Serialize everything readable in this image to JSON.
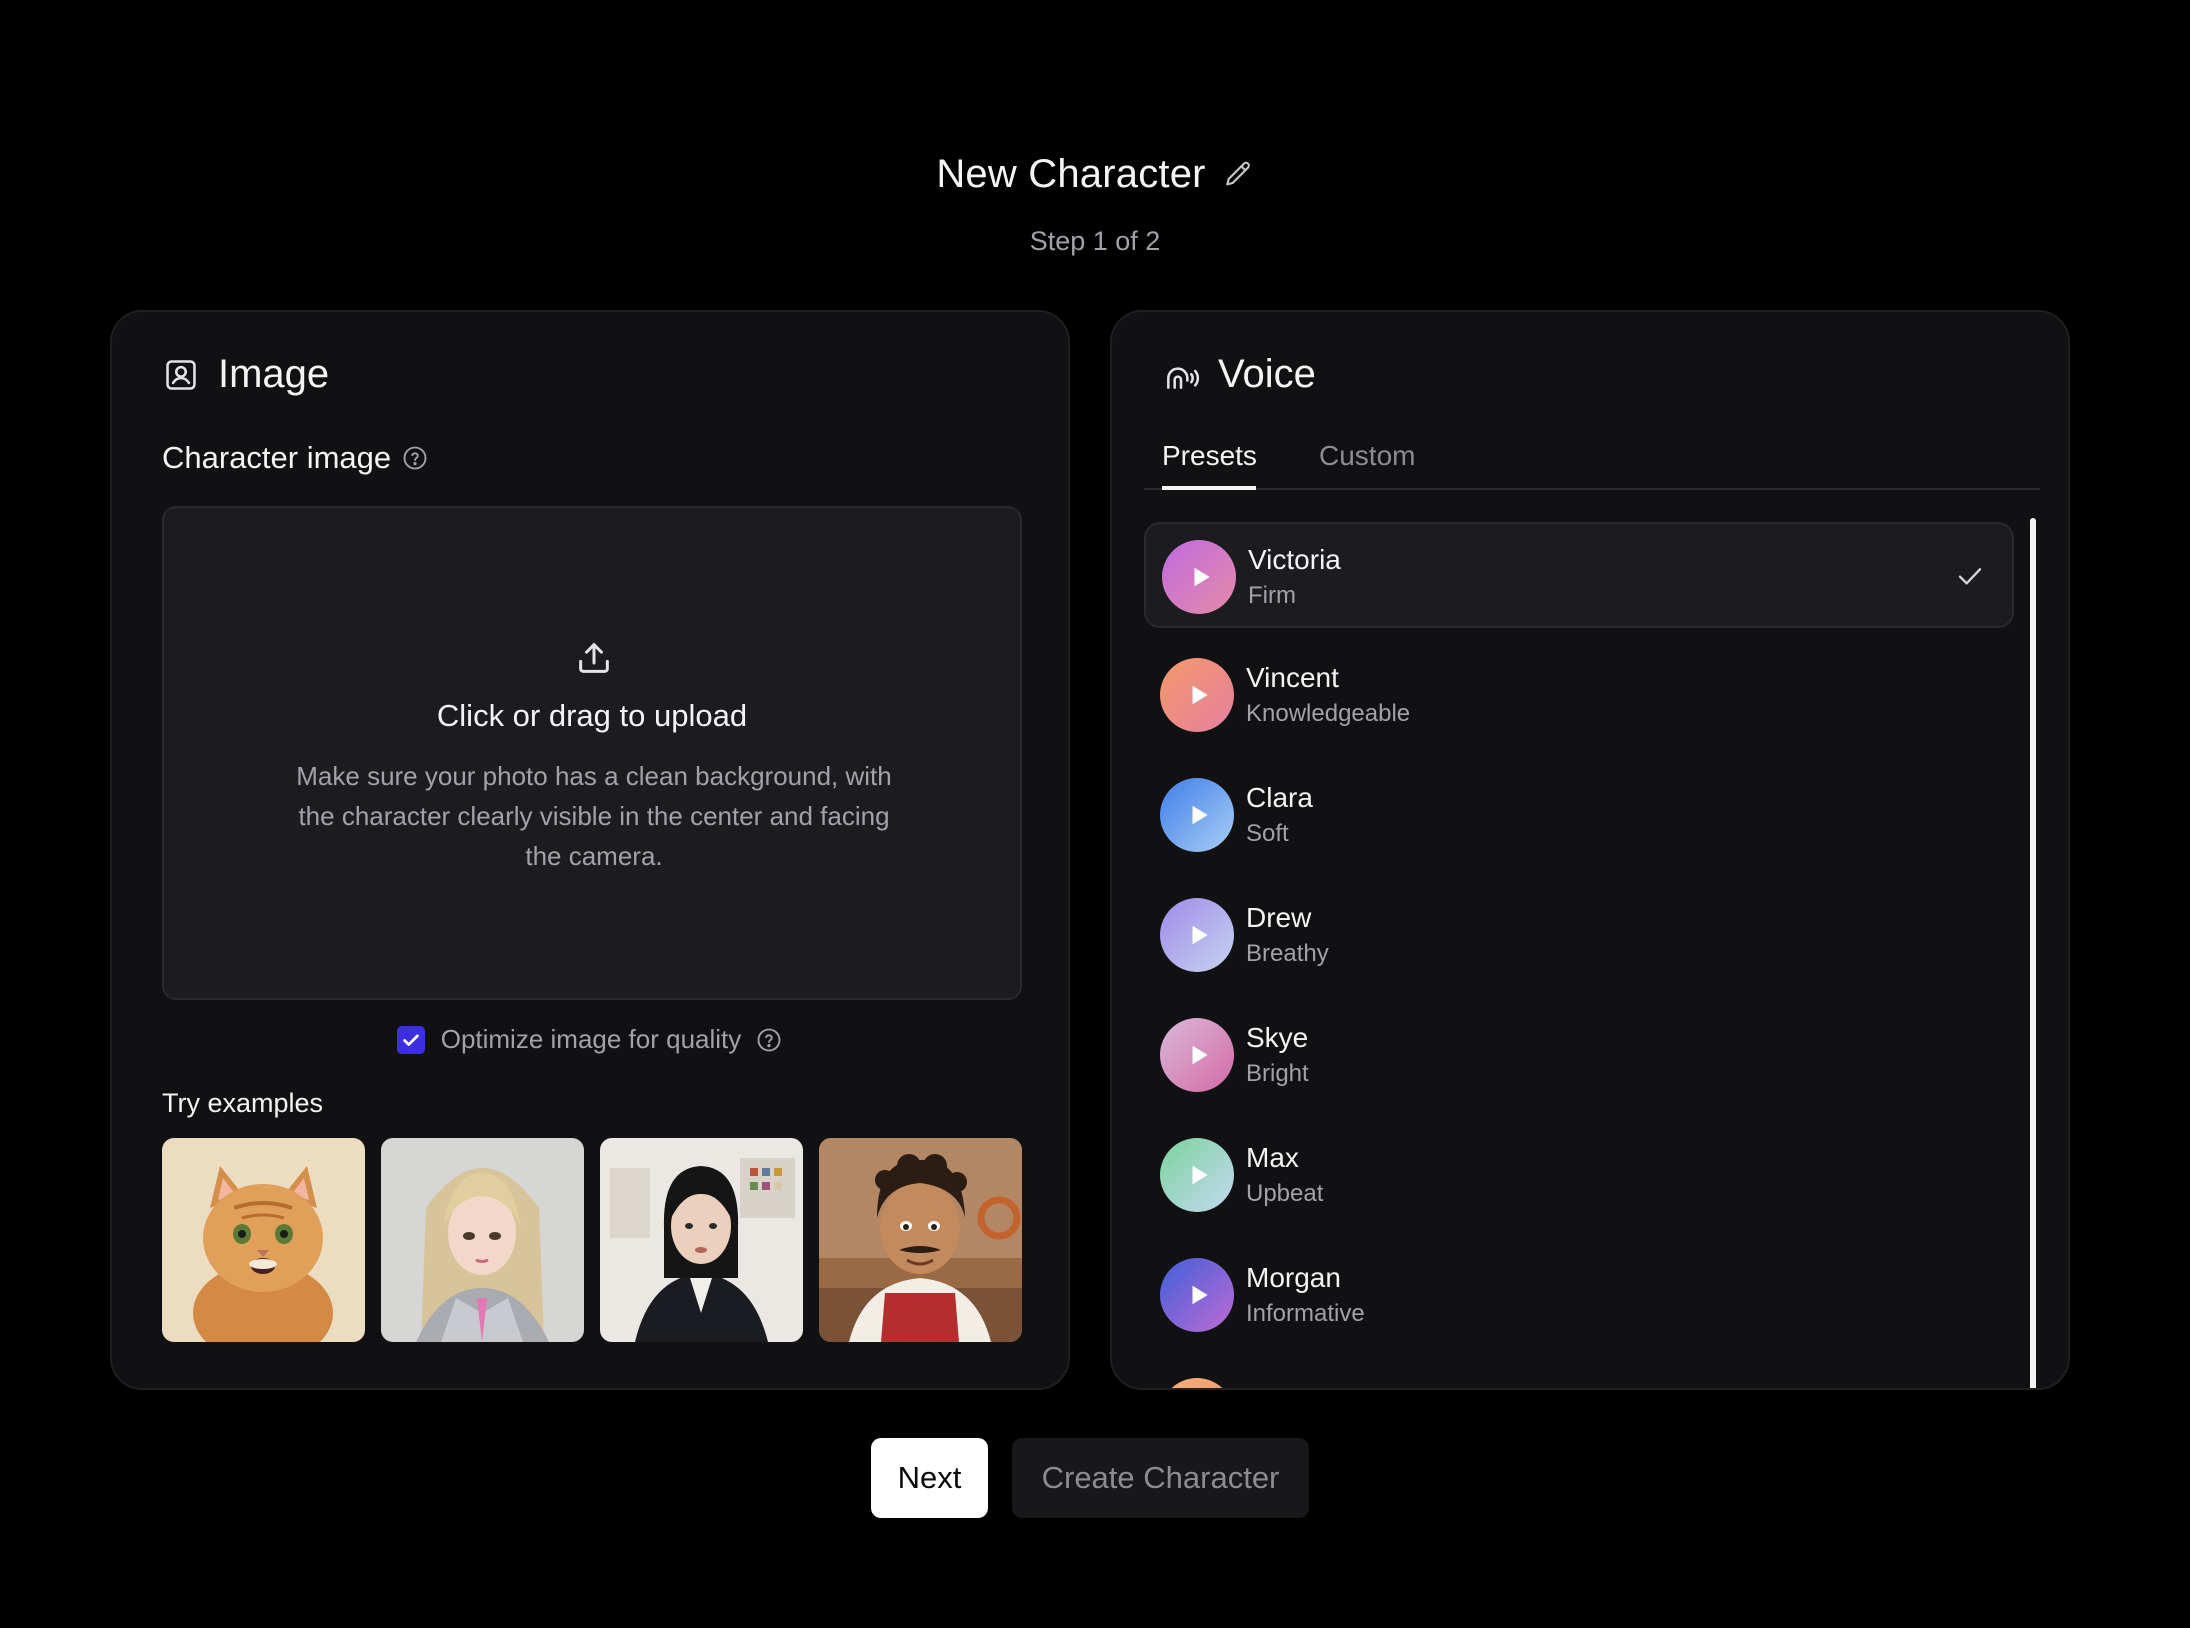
{
  "header": {
    "title": "New Character",
    "step": "Step 1 of 2"
  },
  "image_panel": {
    "heading": "Image",
    "field_label": "Character image",
    "upload_title": "Click or drag to upload",
    "upload_desc": "Make sure your photo has a clean background, with the character clearly visible in the center and facing the camera.",
    "optimize_label": "Optimize image for quality",
    "optimize_checked": true,
    "examples_label": "Try examples",
    "examples": [
      {
        "icon": "cat-example-image"
      },
      {
        "icon": "anime-girl-example-image"
      },
      {
        "icon": "woman-example-image"
      },
      {
        "icon": "chef-example-image"
      }
    ]
  },
  "voice_panel": {
    "heading": "Voice",
    "tabs": [
      {
        "label": "Presets",
        "active": true
      },
      {
        "label": "Custom",
        "active": false
      }
    ],
    "voices": [
      {
        "name": "Victoria",
        "desc": "Firm",
        "selected": true,
        "gradient": [
          "#c06be0",
          "#e58aa8"
        ]
      },
      {
        "name": "Vincent",
        "desc": "Knowledgeable",
        "selected": false,
        "gradient": [
          "#f29a6a",
          "#e57fa0"
        ]
      },
      {
        "name": "Clara",
        "desc": "Soft",
        "selected": false,
        "gradient": [
          "#3f7de8",
          "#a9cff5"
        ]
      },
      {
        "name": "Drew",
        "desc": "Breathy",
        "selected": false,
        "gradient": [
          "#9f8ae8",
          "#c7d3f0"
        ]
      },
      {
        "name": "Skye",
        "desc": "Bright",
        "selected": false,
        "gradient": [
          "#d9b9d8",
          "#d46aa8"
        ]
      },
      {
        "name": "Max",
        "desc": "Upbeat",
        "selected": false,
        "gradient": [
          "#7dd39e",
          "#c2d9f0"
        ]
      },
      {
        "name": "Morgan",
        "desc": "Informative",
        "selected": false,
        "gradient": [
          "#3f5fd8",
          "#c06bd6"
        ]
      }
    ]
  },
  "buttons": {
    "next": "Next",
    "create": "Create Character"
  }
}
